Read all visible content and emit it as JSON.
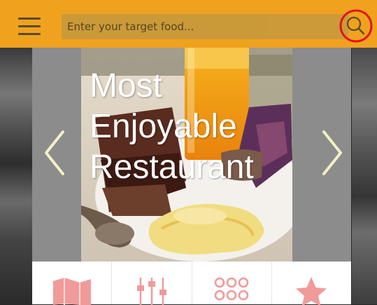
{
  "header": {
    "menu_icon": "hamburger-menu-icon",
    "search": {
      "placeholder": "Enter your target food...",
      "value": "",
      "icon": "search-icon"
    }
  },
  "carousel": {
    "title_lines": [
      "Most",
      "Enjoyable",
      "Restaurant"
    ],
    "prev_icon": "chevron-left-icon",
    "next_icon": "chevron-right-icon"
  },
  "features": [
    {
      "icon": "map-icon"
    },
    {
      "icon": "sliders-icon"
    },
    {
      "icon": "grid-icon"
    },
    {
      "icon": "star-icon"
    }
  ],
  "colors": {
    "header": "#f0a21f",
    "search_highlight": "#e0161c",
    "feature_icon": "#f19a9a",
    "chevron": "#f3efc4"
  }
}
